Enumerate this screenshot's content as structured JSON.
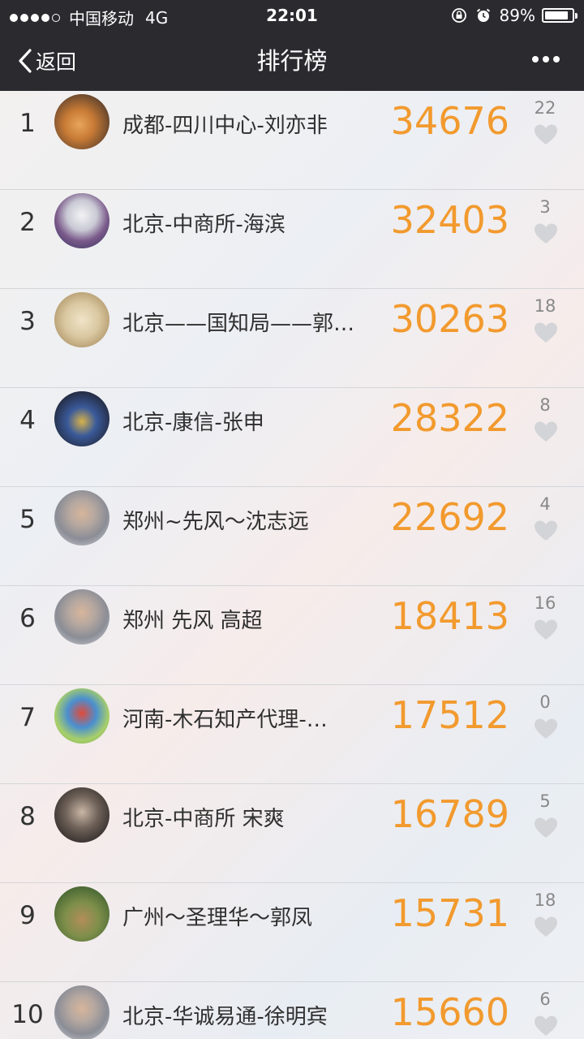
{
  "status_bar": {
    "carrier": "中国移动",
    "network": "4G",
    "time": "22:01",
    "battery_text": "89%",
    "battery_level": 0.89,
    "signal_strength": 4,
    "signal_max": 5
  },
  "nav": {
    "back_label": "返回",
    "title": "排行榜"
  },
  "colors": {
    "score": "#f29a2e",
    "bar": "#2b2b2f"
  },
  "rankings": [
    {
      "rank": "1",
      "name": "成都-四川中心-刘亦非",
      "score": "34676",
      "likes": "22",
      "avatar": "cat-avatar"
    },
    {
      "rank": "2",
      "name": "北京-中商所-海滨",
      "score": "32403",
      "likes": "3",
      "avatar": "anime-character-avatar"
    },
    {
      "rank": "3",
      "name": "北京——国知局——郭…",
      "score": "30263",
      "likes": "18",
      "avatar": "medallion-avatar"
    },
    {
      "rank": "4",
      "name": "北京-康信-张申",
      "score": "28322",
      "likes": "8",
      "avatar": "toys-avatar"
    },
    {
      "rank": "5",
      "name": "郑州~先风～沈志远",
      "score": "22692",
      "likes": "4",
      "avatar": "person-avatar"
    },
    {
      "rank": "6",
      "name": "郑州 先风 高超",
      "score": "18413",
      "likes": "16",
      "avatar": "person-avatar"
    },
    {
      "rank": "7",
      "name": "河南-木石知产代理-…",
      "score": "17512",
      "likes": "0",
      "avatar": "cartoon-figure-avatar"
    },
    {
      "rank": "8",
      "name": "北京-中商所 宋爽",
      "score": "16789",
      "likes": "5",
      "avatar": "child-photo-avatar"
    },
    {
      "rank": "9",
      "name": "广州～圣理华～郭凤",
      "score": "15731",
      "likes": "18",
      "avatar": "outdoor-photo-avatar"
    },
    {
      "rank": "10",
      "name": "北京-华诚易通-徐明宾",
      "score": "15660",
      "likes": "6",
      "avatar": "person-avatar"
    }
  ]
}
